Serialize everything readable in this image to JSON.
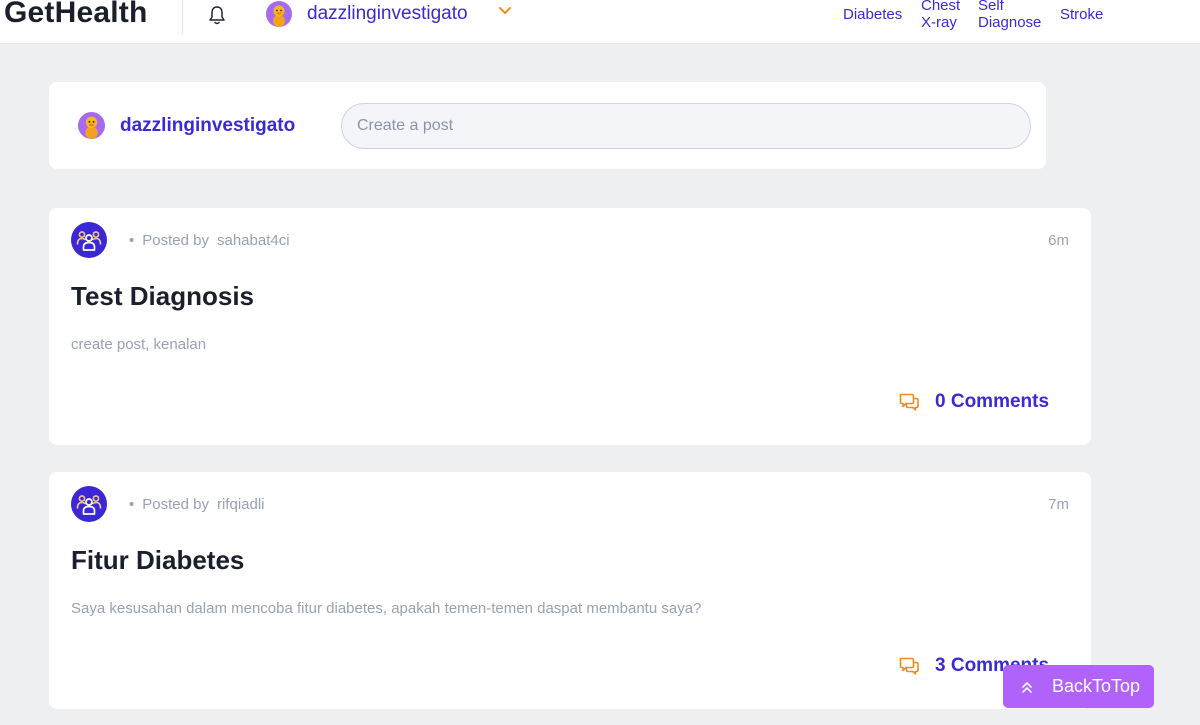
{
  "header": {
    "logo": "GetHealth",
    "username": "dazzlinginvestigato",
    "nav": [
      {
        "label_line1": "Diabetes",
        "label_line2": ""
      },
      {
        "label_line1": "Chest",
        "label_line2": "X-ray"
      },
      {
        "label_line1": "Self",
        "label_line2": "Diagnose"
      },
      {
        "label_line1": "Stroke",
        "label_line2": ""
      }
    ],
    "icons": {
      "notifications": "bell-icon",
      "avatar": "duck-avatar",
      "menu": "chevron-down-icon"
    }
  },
  "create_post": {
    "username": "dazzlinginvestigato",
    "placeholder": "Create a post",
    "value": ""
  },
  "posts": [
    {
      "posted_by_label": "Posted by",
      "author": "sahabat4ci",
      "time": "6m",
      "title": "Test Diagnosis",
      "body": "create post, kenalan",
      "comments_label": "0 Comments",
      "comments_count": 0
    },
    {
      "posted_by_label": "Posted by",
      "author": "rifqiadli",
      "time": "7m",
      "title": "Fitur Diabetes",
      "body": "Saya kesusahan dalam mencoba fitur diabetes, apakah temen-temen daspat membantu saya?",
      "comments_label": "3 Comments",
      "comments_count": 3
    }
  ],
  "back_to_top": {
    "label": "BackToTop",
    "icon": "double-chevron-up-icon"
  },
  "colors": {
    "brand_text": "#3a2ad1",
    "accent_orange": "#f28a1c",
    "group_icon_bg": "#3b27d6",
    "back_to_top_bg": "#b062fb",
    "page_bg": "#eeeff1",
    "muted_text": "#98a2b4"
  }
}
